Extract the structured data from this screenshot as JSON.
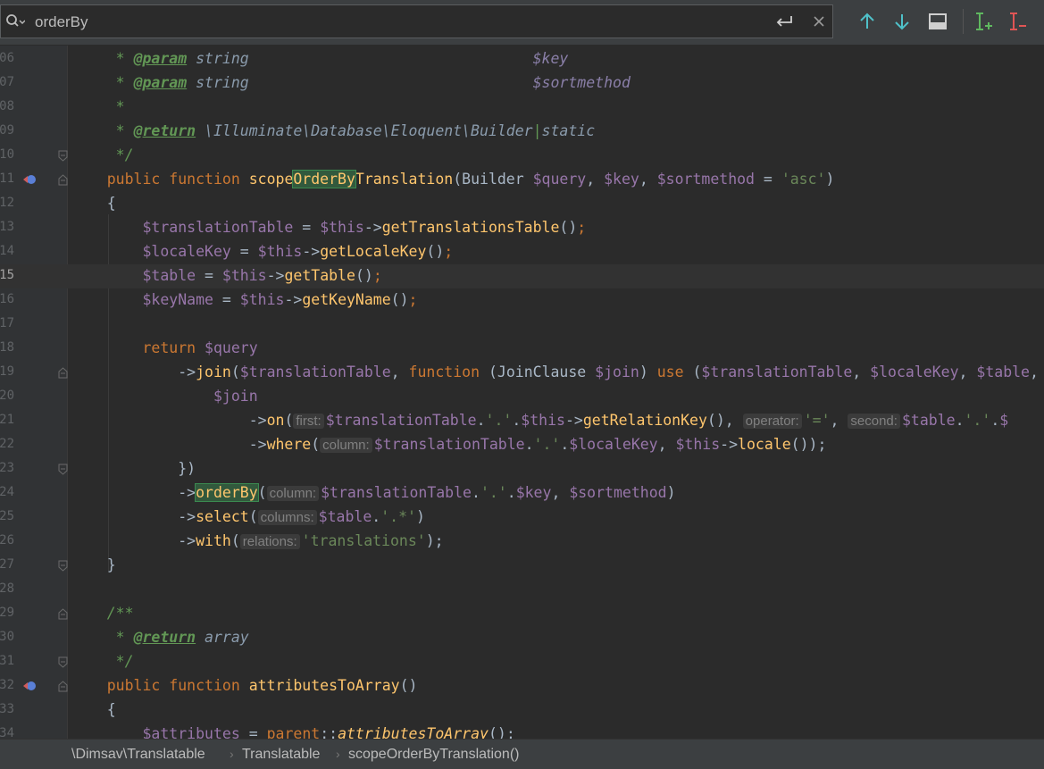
{
  "search": {
    "query": "orderBy"
  },
  "toolbar": {
    "prev_icon": "arrow-up-icon",
    "next_icon": "arrow-down-icon",
    "filter_icon": "window-icon",
    "add_cursor_icon": "add-selection-icon",
    "remove_cursor_icon": "remove-selection-icon"
  },
  "gutter": {
    "line_numbers": [
      "06",
      "07",
      "08",
      "09",
      "10",
      "11",
      "12",
      "13",
      "14",
      "15",
      "16",
      "17",
      "18",
      "19",
      "20",
      "21",
      "22",
      "23",
      "24",
      "25",
      "26",
      "27",
      "28",
      "29",
      "30",
      "31",
      "32",
      "33",
      "34"
    ],
    "current_line": "15"
  },
  "code": {
    "l06": {
      "star": " * ",
      "tag": "@param",
      "type": " string",
      "pad": "                                ",
      "var": "$key"
    },
    "l07": {
      "star": " * ",
      "tag": "@param",
      "type": " string",
      "pad": "                                ",
      "var": "$sortmethod"
    },
    "l08": {
      "text": " *"
    },
    "l09": {
      "star": " * ",
      "tag": "@return",
      "type": " \\Illuminate\\Database\\Eloquent\\Builder",
      "bar": "|",
      "type2": "static"
    },
    "l10": {
      "text": " */"
    },
    "l11": {
      "kw1": "public",
      "kw2": " function ",
      "name_pre": "scope",
      "name_hl": "OrderBy",
      "name_post": "Translation",
      "p1": "(Builder ",
      "v1": "$query",
      "p2": ", ",
      "v2": "$key",
      "p3": ", ",
      "v3": "$sortmethod",
      "p4": " = ",
      "s1": "'asc'",
      "p5": ")"
    },
    "l12": {
      "text": "{"
    },
    "l13": {
      "v1": "$translationTable",
      "p1": " = ",
      "v2": "$this",
      "p2": "->",
      "f1": "getTranslationsTable",
      "p3": "()",
      "semi": ";"
    },
    "l14": {
      "v1": "$localeKey",
      "p1": " = ",
      "v2": "$this",
      "p2": "->",
      "f1": "getLocaleKey",
      "p3": "()",
      "semi": ";"
    },
    "l15": {
      "v1": "$table",
      "p1": " = ",
      "v2": "$this",
      "p2": "->",
      "f1": "getTable",
      "p3": "()",
      "semi": ";"
    },
    "l16": {
      "v1": "$keyName",
      "p1": " = ",
      "v2": "$this",
      "p2": "->",
      "f1": "getKeyName",
      "p3": "()",
      "semi": ";"
    },
    "l18": {
      "kw": "return",
      "p1": " ",
      "v1": "$query"
    },
    "l19": {
      "p1": "->",
      "f1": "join",
      "p2": "(",
      "v1": "$translationTable",
      "p3": ", ",
      "kw1": "function",
      "p4": " (JoinClause ",
      "v2": "$join",
      "p5": ") ",
      "kw2": "use",
      "p6": " (",
      "v3": "$translationTable",
      "p7": ", ",
      "v4": "$localeKey",
      "p8": ", ",
      "v5": "$table",
      "p9": ","
    },
    "l20": {
      "v1": "$join"
    },
    "l21": {
      "p1": "->",
      "f1": "on",
      "p2": "(",
      "h1": "first:",
      "v1": "$translationTable",
      "p3": ".",
      "s1": "'.'",
      "p4": ".",
      "v2": "$this",
      "p5": "->",
      "f2": "getRelationKey",
      "p6": "(), ",
      "h2": "operator:",
      "s2": "'='",
      "p7": ", ",
      "h3": "second:",
      "v3": "$table",
      "p8": ".",
      "s3": "'.'",
      "p9": ".",
      "v4": "$"
    },
    "l22": {
      "p1": "->",
      "f1": "where",
      "p2": "(",
      "h1": "column:",
      "v1": "$translationTable",
      "p3": ".",
      "s1": "'.'",
      "p4": ".",
      "v2": "$localeKey",
      "p5": ", ",
      "v3": "$this",
      "p6": "->",
      "f2": "locale",
      "p7": "());"
    },
    "l23": {
      "text": "})"
    },
    "l24": {
      "p1": "->",
      "f1": "orderBy",
      "p2": "(",
      "h1": "column:",
      "v1": "$translationTable",
      "p3": ".",
      "s1": "'.'",
      "p4": ".",
      "v2": "$key",
      "p5": ", ",
      "v3": "$sortmethod",
      "p6": ")"
    },
    "l25": {
      "p1": "->",
      "f1": "select",
      "p2": "(",
      "h1": "columns:",
      "v1": "$table",
      "p3": ".",
      "s1": "'.*'",
      "p4": ")"
    },
    "l26": {
      "p1": "->",
      "f1": "with",
      "p2": "(",
      "h1": "relations:",
      "s1": "'translations'",
      "p3": ");"
    },
    "l27": {
      "text": "}"
    },
    "l29": {
      "text": "/**"
    },
    "l30": {
      "star": " * ",
      "tag": "@return",
      "type": " array"
    },
    "l31": {
      "text": " */"
    },
    "l32": {
      "kw1": "public",
      "kw2": " function ",
      "f1": "attributesToArray",
      "p1": "()"
    },
    "l33": {
      "text": "{"
    },
    "l34": {
      "v1": "$attributes",
      "p1": " = ",
      "kw1": "parent",
      "p2": "::",
      "f1": "attributesToArray",
      "p3": "();"
    }
  },
  "breadcrumb": {
    "items": [
      "\\Dimsav\\Translatable",
      "Translatable",
      "scopeOrderByTranslation()"
    ]
  },
  "colors": {
    "background": "#2b2b2b",
    "keyword": "#cc7832",
    "function": "#ffc66d",
    "variable": "#9876aa",
    "string": "#6a8759",
    "doc_comment": "#629755",
    "search_highlight": "#32593d"
  }
}
